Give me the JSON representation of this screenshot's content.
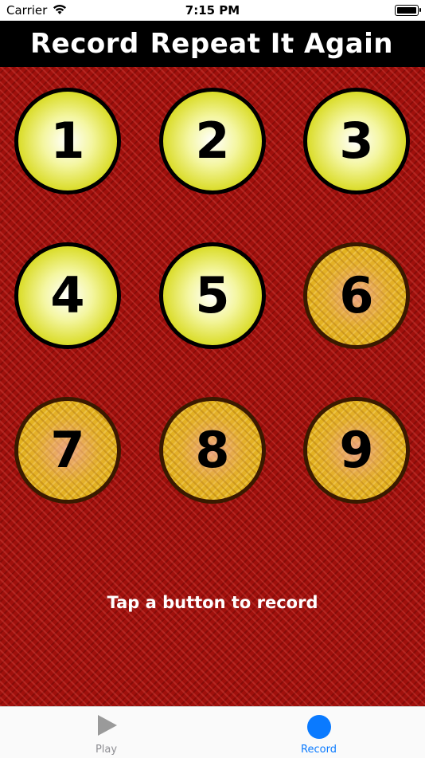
{
  "status_bar": {
    "carrier": "Carrier",
    "time": "7:15 PM"
  },
  "header": {
    "left_title": "Record",
    "right_title": "Repeat It Again"
  },
  "buttons": [
    {
      "label": "1",
      "state": "active"
    },
    {
      "label": "2",
      "state": "active"
    },
    {
      "label": "3",
      "state": "active"
    },
    {
      "label": "4",
      "state": "active"
    },
    {
      "label": "5",
      "state": "active"
    },
    {
      "label": "6",
      "state": "inactive"
    },
    {
      "label": "7",
      "state": "inactive"
    },
    {
      "label": "8",
      "state": "inactive"
    },
    {
      "label": "9",
      "state": "inactive"
    }
  ],
  "hint": "Tap a button to record",
  "tabs": [
    {
      "label": "Play",
      "icon": "play-icon",
      "selected": false
    },
    {
      "label": "Record",
      "icon": "record-icon",
      "selected": true
    }
  ],
  "colors": {
    "background": "#a0100c",
    "active_button": "#d7d91a",
    "inactive_button": "#e3b21d",
    "tab_selected": "#0a7aff",
    "tab_unselected": "#8e8e93"
  }
}
